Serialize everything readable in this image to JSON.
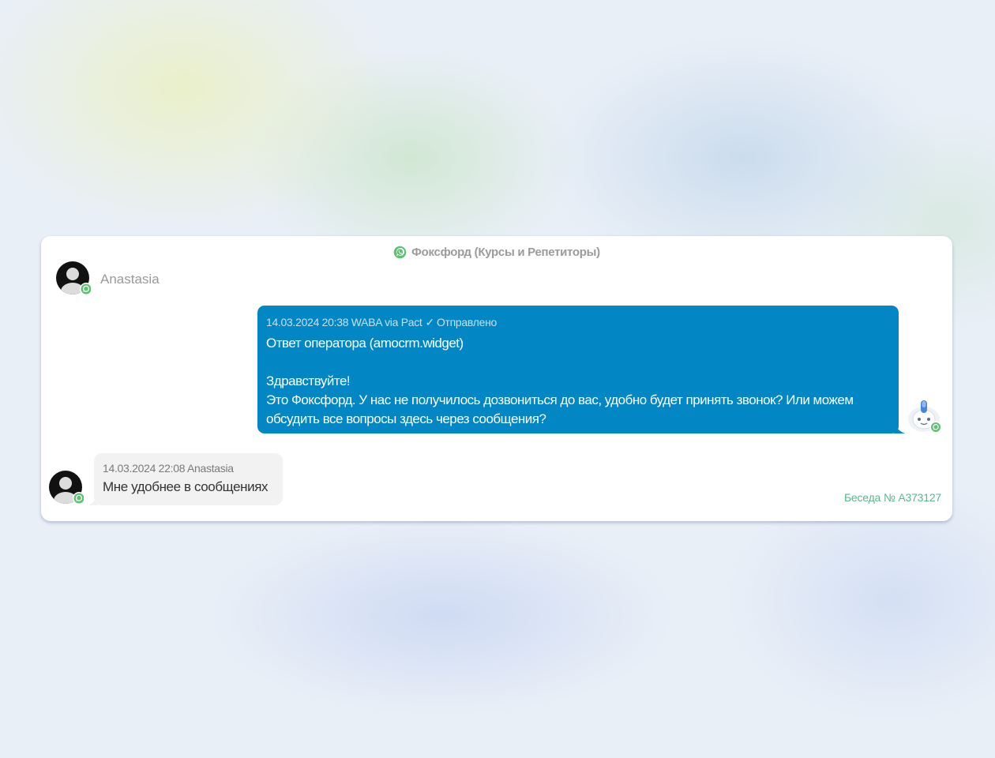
{
  "channel": {
    "icon": "whatsapp-icon",
    "name": "Фоксфорд (Курсы и Репетиторы)"
  },
  "contact": {
    "name": "Anastasia",
    "avatar_icon": "user-avatar-icon",
    "badge_icon": "whatsapp-icon"
  },
  "outgoing_message": {
    "meta_prefix": "14.03.2024 20:38 WABA via Pact",
    "status_icon": "checkmark-icon",
    "status": "Отправлено",
    "body": "Ответ оператора (amocrm.widget)\n\nЗдравствуйте!\nЭто Фоксфорд. У нас не получилось дозвониться до вас, удобно будет принять звонок? Или можем\nобсудить все вопросы здесь через сообщения?",
    "sender_avatar_icon": "bot-avatar-icon"
  },
  "incoming_message": {
    "meta": "14.03.2024 22:08 Anastasia",
    "body": "Мне удобнее в сообщениях"
  },
  "conversation": {
    "label": "Беседа № A373127"
  },
  "colors": {
    "outgoing_bubble": "#0386c4",
    "incoming_bubble": "#f2f2f2",
    "whatsapp_green": "#4caf50",
    "conversation_link": "#59b98b"
  }
}
